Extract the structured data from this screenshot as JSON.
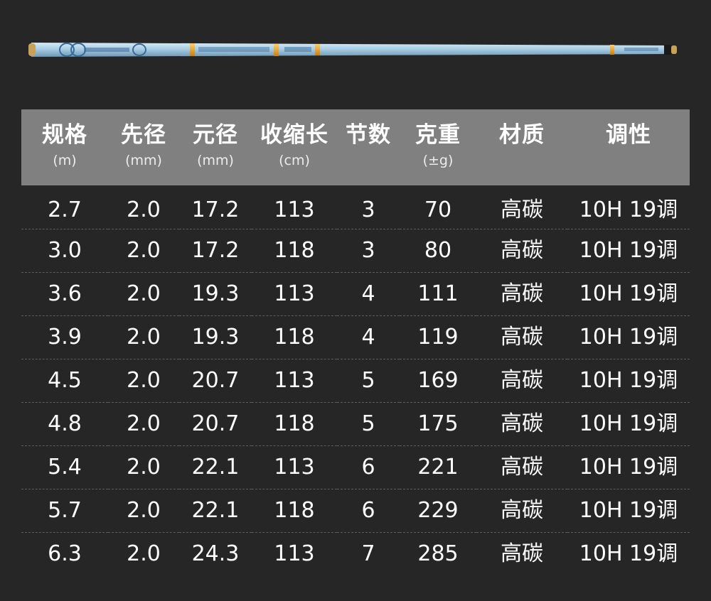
{
  "product": {
    "image_name": "fishing-rod-image"
  },
  "table": {
    "headers": [
      {
        "label": "规格",
        "unit": "(m)"
      },
      {
        "label": "先径",
        "unit": "(mm)"
      },
      {
        "label": "元径",
        "unit": "(mm)"
      },
      {
        "label": "收缩长",
        "unit": "(cm)"
      },
      {
        "label": "节数",
        "unit": ""
      },
      {
        "label": "克重",
        "unit": "(±g)"
      },
      {
        "label": "材质",
        "unit": ""
      },
      {
        "label": "调性",
        "unit": ""
      }
    ],
    "rows": [
      [
        "2.7",
        "2.0",
        "17.2",
        "113",
        "3",
        "70",
        "高碳",
        "10H 19调"
      ],
      [
        "3.0",
        "2.0",
        "17.2",
        "118",
        "3",
        "80",
        "高碳",
        "10H 19调"
      ],
      [
        "3.6",
        "2.0",
        "19.3",
        "113",
        "4",
        "111",
        "高碳",
        "10H 19调"
      ],
      [
        "3.9",
        "2.0",
        "19.3",
        "118",
        "4",
        "119",
        "高碳",
        "10H 19调"
      ],
      [
        "4.5",
        "2.0",
        "20.7",
        "113",
        "5",
        "169",
        "高碳",
        "10H 19调"
      ],
      [
        "4.8",
        "2.0",
        "20.7",
        "118",
        "5",
        "175",
        "高碳",
        "10H 19调"
      ],
      [
        "5.4",
        "2.0",
        "22.1",
        "113",
        "6",
        "221",
        "高碳",
        "10H 19调"
      ],
      [
        "5.7",
        "2.0",
        "22.1",
        "118",
        "6",
        "229",
        "高碳",
        "10H 19调"
      ],
      [
        "6.3",
        "2.0",
        "24.3",
        "113",
        "7",
        "285",
        "高碳",
        "10H 19调"
      ]
    ]
  },
  "colors": {
    "background": "#262626",
    "header_background": "#808080",
    "rod_blue": "#9fc4dd",
    "rod_band": "#e8a020"
  }
}
